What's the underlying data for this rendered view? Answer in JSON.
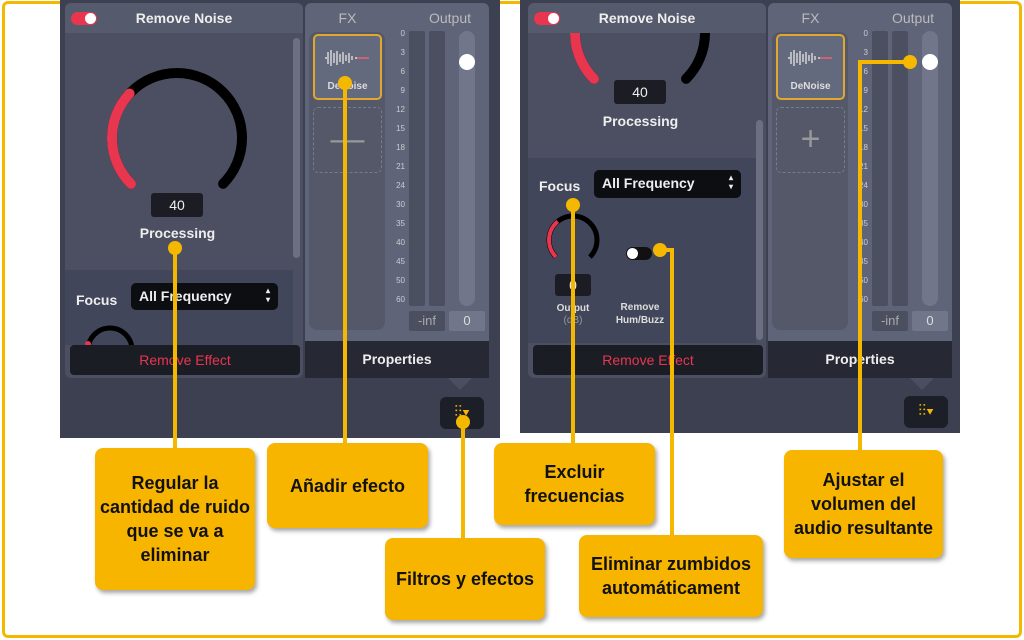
{
  "accent": "#e8364f",
  "callout_color": "#f7b500",
  "panels": [
    {
      "title": "Remove Noise",
      "processing_value": "40",
      "processing_label": "Processing",
      "processing_fraction": 0.4,
      "focus_label": "Focus",
      "focus_value": "All Frequency",
      "remove_effect": "Remove Effect",
      "fx_label": "FX",
      "output_label": "Output",
      "effect_name": "DeNoise",
      "add_icon": "plus-icon",
      "scale": [
        "0",
        "3",
        "6",
        "9",
        "12",
        "15",
        "18",
        "21",
        "24",
        "30",
        "35",
        "40",
        "45",
        "50",
        "60"
      ],
      "peak": "-inf",
      "gain": "0",
      "properties": "Properties",
      "mixer_icon": "sliders-icon"
    },
    {
      "title": "Remove Noise",
      "processing_value": "40",
      "processing_label": "Processing",
      "focus_label": "Focus",
      "focus_value": "All Frequency",
      "output_knob_value": "0",
      "output_knob_label": "Output",
      "output_knob_unit": "(dB)",
      "hum_label": "Remove",
      "hum_label2": "Hum/Buzz",
      "hum_enabled": false,
      "remove_effect": "Remove Effect",
      "fx_label": "FX",
      "output_label": "Output",
      "effect_name": "DeNoise",
      "scale": [
        "0",
        "3",
        "6",
        "9",
        "12",
        "15",
        "18",
        "21",
        "24",
        "30",
        "35",
        "40",
        "45",
        "50",
        "60"
      ],
      "peak": "-inf",
      "gain": "0",
      "properties": "Properties"
    }
  ],
  "callouts": [
    "Regular la cantidad de ruido que se va a eliminar",
    "Añadir efecto",
    "Filtros y efectos",
    "Excluir frecuencias",
    "Eliminar zumbidos automáticament",
    "Ajustar el volumen del audio resultante"
  ]
}
